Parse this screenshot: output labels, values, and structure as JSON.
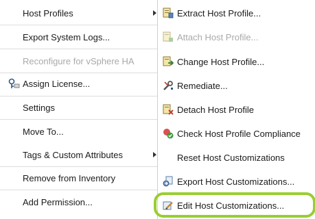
{
  "main_menu": {
    "host_profiles": "Host Profiles",
    "export_system_logs": "Export System Logs...",
    "reconfigure_ha": "Reconfigure for vSphere HA",
    "assign_license": "Assign License...",
    "settings": "Settings",
    "move_to": "Move To...",
    "tags_custom_attributes": "Tags & Custom Attributes",
    "remove_from_inventory": "Remove from Inventory",
    "add_permission": "Add Permission..."
  },
  "sub_menu": {
    "extract": "Extract Host Profile...",
    "attach": "Attach Host Profile...",
    "change": "Change Host Profile...",
    "remediate": "Remediate...",
    "detach": "Detach Host Profile",
    "check_compliance": "Check Host Profile Compliance",
    "reset_customizations": "Reset Host Customizations",
    "export_customizations": "Export Host Customizations...",
    "edit_customizations": "Edit Host Customizations..."
  },
  "colors": {
    "highlight_ring": "#9acd32",
    "disabled_text": "#a9a9a9"
  }
}
